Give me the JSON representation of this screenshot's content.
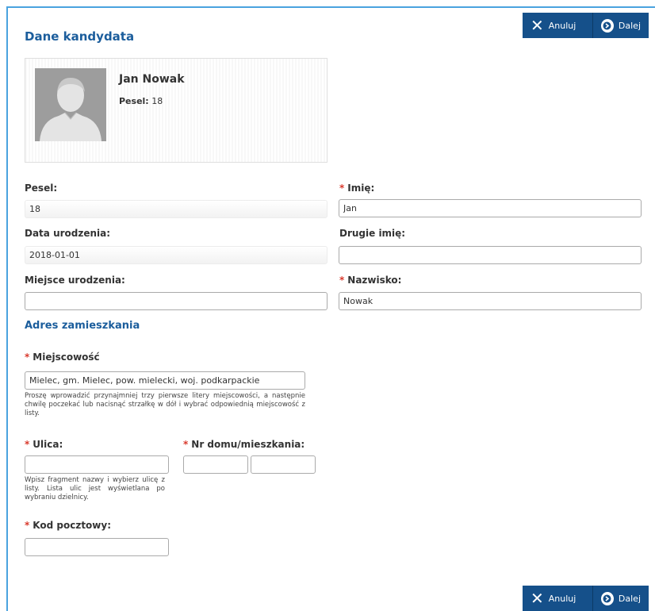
{
  "toolbar": {
    "cancel_label": "Anuluj",
    "next_label": "Dalej"
  },
  "candidate": {
    "section_title": "Dane kandydata",
    "name": "Jan Nowak",
    "pesel_label": "Pesel:",
    "pesel_value": "18"
  },
  "form": {
    "pesel": {
      "label": "Pesel:",
      "value": "18"
    },
    "first_name": {
      "label": "Imię:",
      "value": "Jan"
    },
    "birth_date": {
      "label": "Data urodzenia:",
      "value": "2018-01-01"
    },
    "second_name": {
      "label": "Drugie imię:",
      "value": ""
    },
    "birth_place": {
      "label": "Miejsce urodzenia:",
      "value": ""
    },
    "surname": {
      "label": "Nazwisko:",
      "value": "Nowak"
    }
  },
  "address": {
    "section_title": "Adres zamieszkania",
    "city": {
      "label": "Miejscowość",
      "value": "Mielec, gm. Mielec, pow. mielecki, woj. podkarpackie",
      "hint": "Proszę wprowadzić przynajmniej trzy pierwsze litery miejscowości, a następnie chwilę poczekać lub nacisnąć strzałkę w dół i wybrać odpowiednią miejscowość z listy."
    },
    "street": {
      "label": "Ulica:",
      "value": "",
      "hint": "Wpisz fragment nazwy i wybierz ulicę z listy. Lista ulic jest wyświetlana po wybraniu dzielnicy."
    },
    "house_no": {
      "label": "Nr domu/mieszkania:",
      "house": "",
      "flat": ""
    },
    "postal_code": {
      "label": "Kod pocztowy:",
      "value": ""
    }
  },
  "required_mark": "*",
  "colors": {
    "accent": "#15508a",
    "title": "#1b5d9c",
    "required": "#d9392c",
    "frame": "#4aa3df"
  },
  "icons": {
    "cancel": "x-icon",
    "next": "circle-arrow-right-icon",
    "avatar": "user-silhouette-icon"
  }
}
